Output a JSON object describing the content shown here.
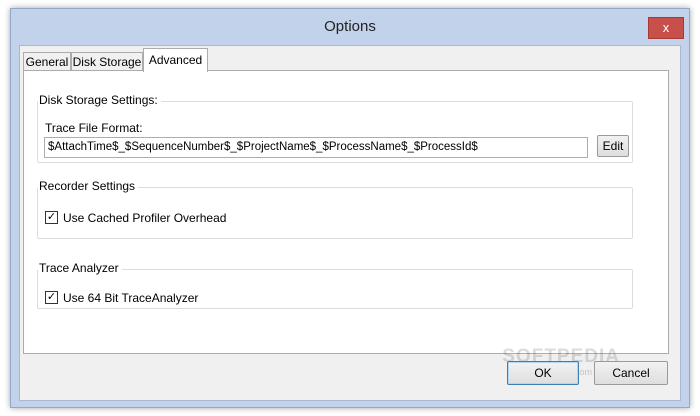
{
  "window": {
    "title": "Options",
    "close_glyph": "x"
  },
  "tabs": [
    {
      "label": "General",
      "active": false
    },
    {
      "label": "Disk Storage",
      "active": false
    },
    {
      "label": "Advanced",
      "active": true
    }
  ],
  "disk_storage": {
    "legend": "Disk Storage Settings:",
    "trace_label": "Trace File Format:",
    "trace_value": "$AttachTime$_$SequenceNumber$_$ProjectName$_$ProcessName$_$ProcessId$",
    "edit_label": "Edit"
  },
  "recorder": {
    "legend": "Recorder Settings",
    "checkbox_label": "Use Cached Profiler Overhead",
    "checked": true,
    "check_glyph": "✓"
  },
  "trace_analyzer": {
    "legend": "Trace Analyzer",
    "checkbox_label": "Use 64 Bit TraceAnalyzer",
    "checked": true,
    "check_glyph": "✓"
  },
  "footer": {
    "ok_label": "OK",
    "cancel_label": "Cancel"
  },
  "watermark": {
    "text": "SOFTPEDIA",
    "url": "www.softpedia.com"
  },
  "colors": {
    "titlebar": "#c1d2ea",
    "close_button": "#c7504b",
    "panel": "#ffffff",
    "client": "#f0f0f0"
  },
  "icons": {
    "close": "close-icon",
    "check": "checkmark-icon"
  }
}
